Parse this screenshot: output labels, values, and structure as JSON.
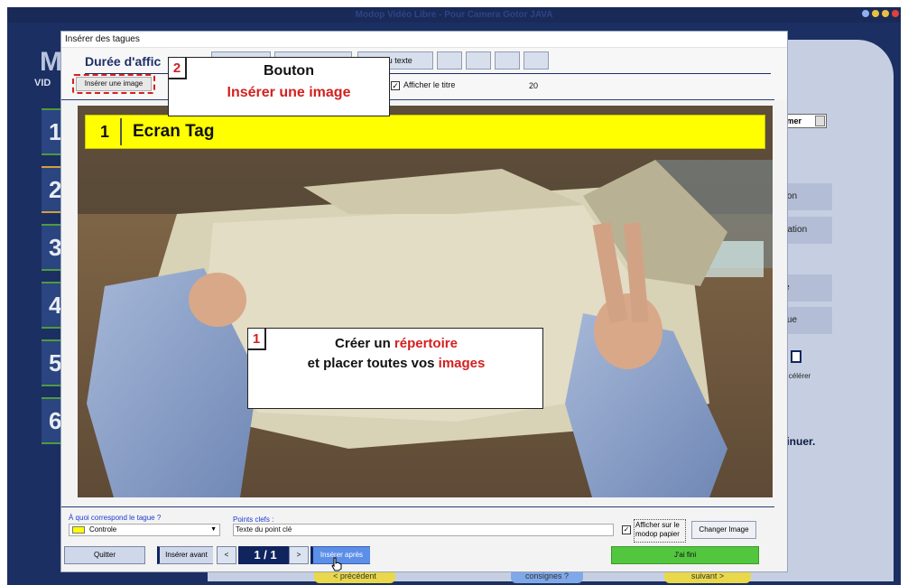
{
  "background_app": {
    "window_title": "Modop Vidéo Libre - Pour Camera Gotor JAVA",
    "logo_letter": "M",
    "logo_sub": "VID",
    "step_numbers": [
      "1",
      "2",
      "3",
      "4",
      "5",
      "6"
    ],
    "right_select": "élémer",
    "right_items": [
      "ration",
      "pération",
      "gue",
      "tague"
    ],
    "accelerer": "célérer",
    "continuer": "ntinuer.",
    "nav_prev": "< précédent",
    "nav_mid": "consignes ?",
    "nav_next": "suivant >"
  },
  "dialog": {
    "title": "Insérer des tagues",
    "duree_label": "Durée d'affic",
    "toolbar_buttons": [
      "",
      "",
      "r du texte",
      "",
      "",
      "",
      ""
    ],
    "btn_inserer_image": "Insérer une image",
    "afficher_titre_checked": "✓",
    "afficher_titre_label": "Afficher le titre",
    "value_20": "20"
  },
  "image": {
    "banner_num": "1",
    "banner_text": "Ecran Tag",
    "callout1": {
      "num": "1",
      "line1_a": "Créer un",
      "line1_b": "répertoire",
      "line2_a": "et placer toutes vos",
      "line2_b": "images"
    },
    "callout2": {
      "num": "2",
      "line1": "Bouton",
      "line2": "Insérer une image"
    }
  },
  "bottom": {
    "label_quoi": "À quoi correspond le tague ?",
    "select_quoi_value": "Controle",
    "label_points": "Points clefs :",
    "points_value": "Texte du point clé",
    "modop_checked": "✓",
    "modop_label": "Afficher sur le modop papier",
    "btn_changer": "Changer Image",
    "btn_quitter": "Quitter",
    "btn_avant": "Insérer avant",
    "btn_prev": "<",
    "page_counter": "1 / 1",
    "btn_next": ">",
    "btn_apres": "Insérer après",
    "btn_fini": "J'ai fini"
  },
  "colors": {
    "accent_navy": "#10245e",
    "banner_yellow": "#ffff00",
    "callout_red": "#d42020",
    "finish_green": "#52c63e",
    "apres_blue": "#5c8fe8"
  }
}
